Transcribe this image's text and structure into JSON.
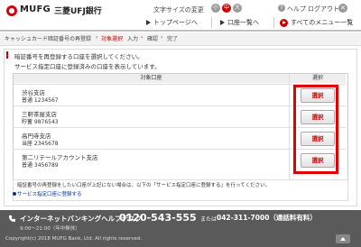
{
  "header": {
    "bank_name_en": "MUFG",
    "bank_name_ja": "三菱UFJ銀行",
    "font_size_label": "文字サイズの変更",
    "font_sizes": [
      "小",
      "中",
      "大"
    ],
    "help_label": "ヘルプ",
    "help_icon": "question-icon",
    "logout_label": "ログアウト",
    "close_icon": "close-icon",
    "nav": {
      "top_label": "トップページへ",
      "accounts_label": "口座一覧へ",
      "menu_label": "すべてのメニュー一覧"
    }
  },
  "breadcrumb": {
    "items": [
      "キャッシュカード暗証番号の再登録",
      "対象選択",
      "入力",
      "確認",
      "完了"
    ],
    "active_index": 1
  },
  "main": {
    "instruction": "暗証番号を再登録する口座を選択してください。",
    "sub_instruction": "サービス指定口座に登録済みの口座を表示しています。",
    "table": {
      "headers": [
        "対象口座",
        "選択"
      ],
      "rows": [
        {
          "branch": "渋谷支店",
          "account": "普通 1234567",
          "button": "選択"
        },
        {
          "branch": "三軒茶屋支店",
          "account": "貯蓄 9876543",
          "button": "選択"
        },
        {
          "branch": "高円寺支店",
          "account": "当座 2345678",
          "button": "選択"
        },
        {
          "branch": "第二リテールアカウント支店",
          "account": "普通 3456789",
          "button": "選択"
        }
      ]
    },
    "note": "暗証番号の再登録をしたい口座が上記にない場合は、以下の「サービス指定口座に登録する」を行ってください。",
    "note_link": "サービス指定口座に登録する"
  },
  "footer": {
    "helpdesk_title": "インターネットバンキングヘルプデスク",
    "phone": "0120-543-555",
    "or_label": "または",
    "phone2": "042-311-7000（通話料有料）",
    "hours": "9:00～21:00（年中無休）",
    "copyright": "Copyright(c) 2018 MUFG Bank, Ltd. All rights reserved.",
    "pagetop_icon": "arrow-up-icon"
  },
  "colors": {
    "brand_red": "#d8000f",
    "highlight": "#e00000",
    "footer_bg": "#5a5a5a"
  }
}
